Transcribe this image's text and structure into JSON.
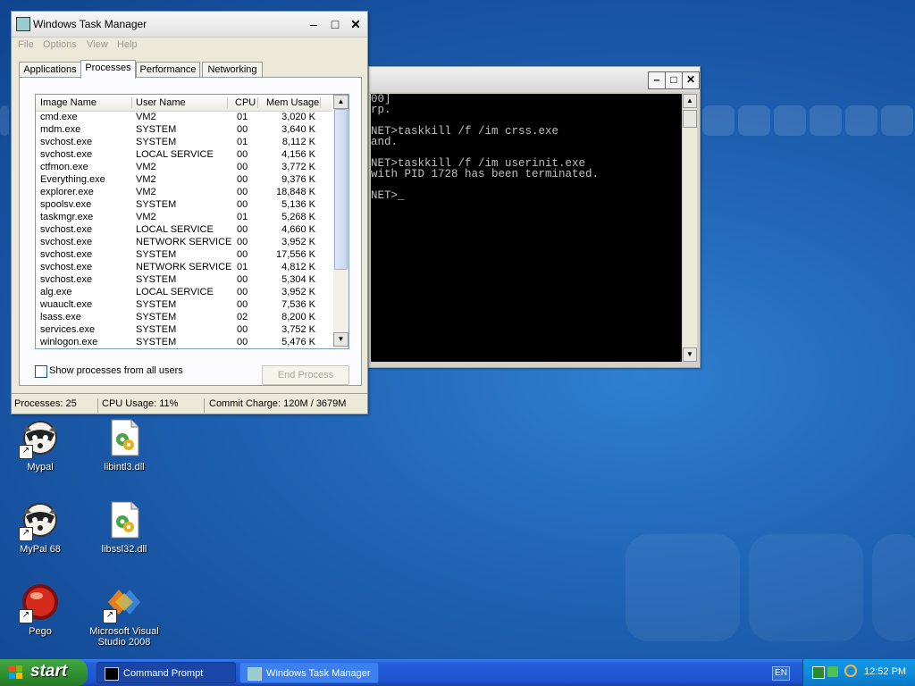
{
  "colors": {
    "taskbar": "#245edb",
    "start_button": "#3c9b3c",
    "console_bg": "#000000",
    "console_text": "#c0c0c0",
    "desktop": "#1f63b4"
  },
  "console": {
    "lines": [
      "00]",
      "rp.",
      "",
      "NET>taskkill /f /im crss.exe",
      "and.",
      "",
      "NET>taskkill /f /im userinit.exe",
      "with PID 1728 has been terminated.",
      "",
      "NET>_"
    ]
  },
  "task_manager": {
    "title": "Windows Task Manager",
    "menu": [
      "File",
      "Options",
      "View",
      "Help"
    ],
    "tabs": [
      "Applications",
      "Processes",
      "Performance",
      "Networking"
    ],
    "active_tab": "Processes",
    "columns": [
      "Image Name",
      "User Name",
      "CPU",
      "Mem Usage"
    ],
    "processes": [
      [
        "cmd.exe",
        "VM2",
        "01",
        "3,020 K"
      ],
      [
        "mdm.exe",
        "SYSTEM",
        "00",
        "3,640 K"
      ],
      [
        "svchost.exe",
        "SYSTEM",
        "01",
        "8,112 K"
      ],
      [
        "svchost.exe",
        "LOCAL SERVICE",
        "00",
        "4,156 K"
      ],
      [
        "ctfmon.exe",
        "VM2",
        "00",
        "3,772 K"
      ],
      [
        "Everything.exe",
        "VM2",
        "00",
        "9,376 K"
      ],
      [
        "explorer.exe",
        "VM2",
        "00",
        "18,848 K"
      ],
      [
        "spoolsv.exe",
        "SYSTEM",
        "00",
        "5,136 K"
      ],
      [
        "taskmgr.exe",
        "VM2",
        "01",
        "5,268 K"
      ],
      [
        "svchost.exe",
        "LOCAL SERVICE",
        "00",
        "4,660 K"
      ],
      [
        "svchost.exe",
        "NETWORK SERVICE",
        "00",
        "3,952 K"
      ],
      [
        "svchost.exe",
        "SYSTEM",
        "00",
        "17,556 K"
      ],
      [
        "svchost.exe",
        "NETWORK SERVICE",
        "01",
        "4,812 K"
      ],
      [
        "svchost.exe",
        "SYSTEM",
        "00",
        "5,304 K"
      ],
      [
        "alg.exe",
        "LOCAL SERVICE",
        "00",
        "3,952 K"
      ],
      [
        "wuauclt.exe",
        "SYSTEM",
        "00",
        "7,536 K"
      ],
      [
        "lsass.exe",
        "SYSTEM",
        "02",
        "8,200 K"
      ],
      [
        "services.exe",
        "SYSTEM",
        "00",
        "3,752 K"
      ],
      [
        "winlogon.exe",
        "SYSTEM",
        "00",
        "5,476 K"
      ]
    ],
    "show_all_label": "Show processes from all users",
    "end_process_label": "End Process",
    "status": {
      "processes": "Processes: 25",
      "cpu": "CPU Usage: 11%",
      "commit": "Commit Charge: 120M / 3679M"
    }
  },
  "desktop_icons": [
    {
      "label": "Mypal",
      "icon": "raccoon-icon"
    },
    {
      "label": "libintl3.dll",
      "icon": "dll-file-icon"
    },
    {
      "label": "MyPal 68",
      "icon": "raccoon-icon"
    },
    {
      "label": "libssl32.dll",
      "icon": "dll-file-icon"
    },
    {
      "label": "Pego",
      "icon": "red-orb-icon"
    },
    {
      "label": "Microsoft Visual Studio 2008",
      "icon": "visual-studio-icon"
    }
  ],
  "taskbar": {
    "start_label": "start",
    "tasks": [
      "Command Prompt",
      "Windows Task Manager"
    ],
    "language": "EN",
    "clock": "12:52 PM"
  }
}
